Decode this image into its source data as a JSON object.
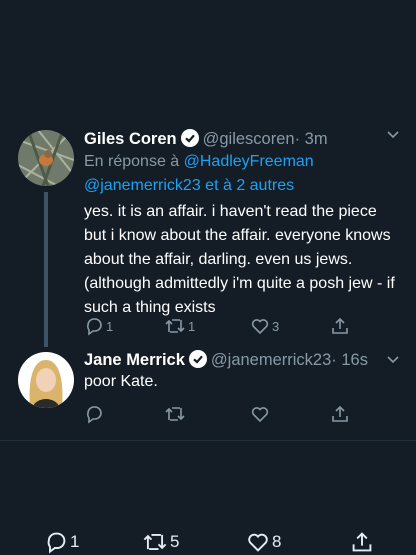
{
  "tweet1": {
    "name": "Giles Coren",
    "handle": "@gilescoren",
    "time": "· 3m",
    "reply_prefix": "En réponse à ",
    "reply_user1": "@HadleyFreeman",
    "reply_user2": "@janemerrick23",
    "reply_suffix": " et à 2 autres",
    "text": "yes. it is an affair. i haven't read the piece but i know about the affair. everyone knows about the affair, darling. even us jews. (although admittedly i'm quite a posh jew - if such a thing exists",
    "reply_count": "1",
    "retweet_count": "1",
    "like_count": "3"
  },
  "tweet2": {
    "name": "Jane Merrick",
    "handle": "@janemerrick23",
    "time": "· 16s",
    "text": "poor Kate."
  },
  "bottom": {
    "reply_count": "1",
    "retweet_count": "5",
    "like_count": "8"
  },
  "colors": {
    "background": "#141d26",
    "link": "#1da1f2",
    "muted": "#8899a6"
  }
}
